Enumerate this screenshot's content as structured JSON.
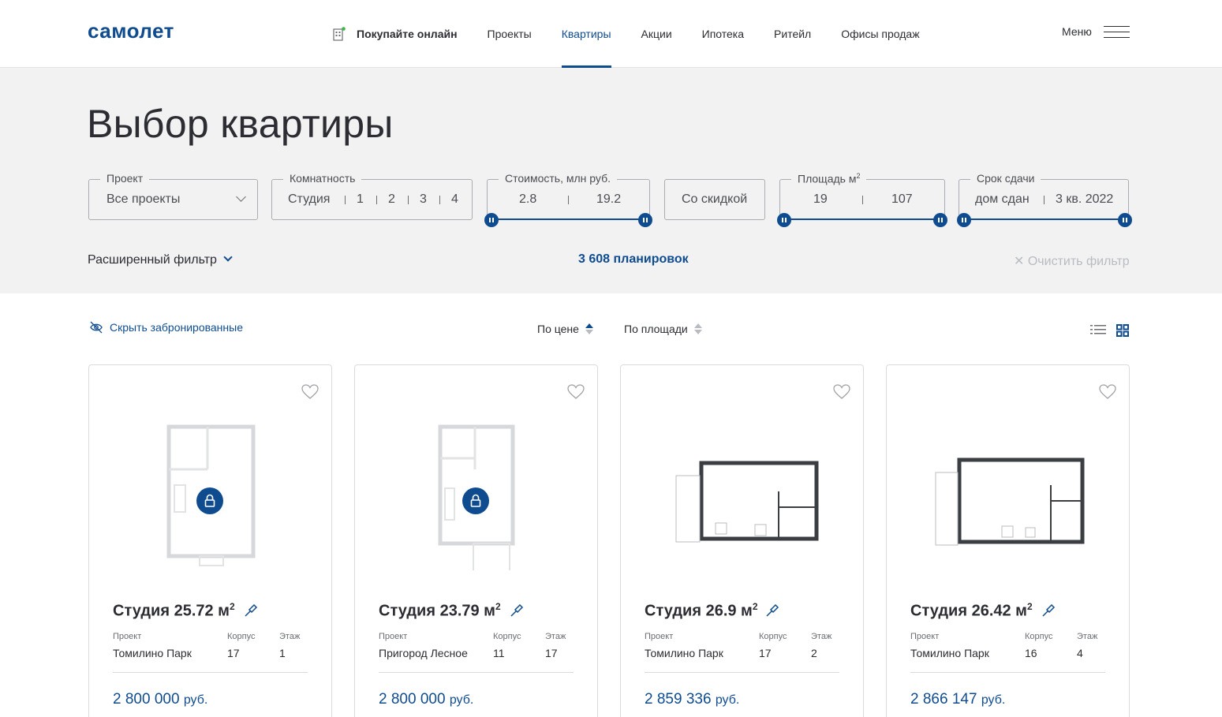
{
  "header": {
    "logo": "самолет",
    "online": "Покупайте онлайн",
    "nav": [
      "Проекты",
      "Квартиры",
      "Акции",
      "Ипотека",
      "Ритейл",
      "Офисы продаж"
    ],
    "menu": "Меню"
  },
  "page_title": "Выбор квартиры",
  "filters": {
    "project": {
      "label": "Проект",
      "value": "Все проекты"
    },
    "rooms": {
      "label": "Комнатность",
      "options": [
        "Студия",
        "1",
        "2",
        "3",
        "4"
      ]
    },
    "price": {
      "label": "Стоимость, млн руб.",
      "min": "2.8",
      "max": "19.2"
    },
    "discount": "Со скидкой",
    "area": {
      "label": "Площадь м",
      "min": "19",
      "max": "107"
    },
    "deadline": {
      "label": "Срок сдачи",
      "min": "дом сдан",
      "max": "3 кв. 2022"
    }
  },
  "advanced_filter": "Расширенный фильтр",
  "count": "3 608 планировок",
  "clear": "Очистить фильтр",
  "hide_booked": "Скрыть забронированные",
  "sort": {
    "by_price": "По цене",
    "by_area": "По площади"
  },
  "meta_labels": {
    "project": "Проект",
    "building": "Корпус",
    "floor": "Этаж"
  },
  "currency": "руб.",
  "cards": [
    {
      "title": "Студия 25.72 м",
      "project": "Томилино Парк",
      "building": "17",
      "floor": "1",
      "price": "2 800 000",
      "booked": true
    },
    {
      "title": "Студия 23.79 м",
      "project": "Пригород Лесное",
      "building": "11",
      "floor": "17",
      "price": "2 800 000",
      "booked": true
    },
    {
      "title": "Студия 26.9 м",
      "project": "Томилино Парк",
      "building": "17",
      "floor": "2",
      "price": "2 859 336",
      "booked": false
    },
    {
      "title": "Студия 26.42 м",
      "project": "Томилино Парк",
      "building": "16",
      "floor": "4",
      "price": "2 866 147",
      "booked": false
    }
  ],
  "colors": {
    "accent": "#0f4c8f",
    "panel_bg": "#f2f2f2"
  }
}
